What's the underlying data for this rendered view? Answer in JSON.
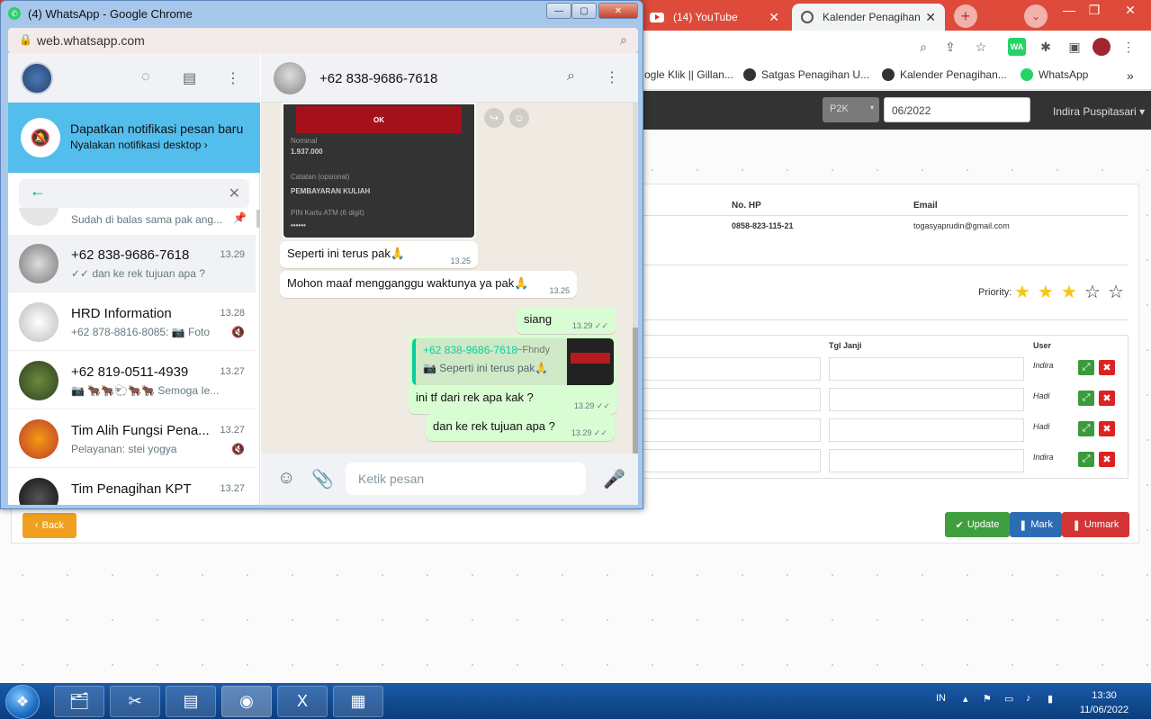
{
  "browser_bg": {
    "tabs": [
      {
        "label": "(14) YouTube"
      },
      {
        "label": "Kalender Penagihan"
      }
    ],
    "bookmarks": [
      {
        "label": "ogle Klik || Gillan..."
      },
      {
        "label": "Satgas Penagihan U..."
      },
      {
        "label": "Kalender Penagihan..."
      },
      {
        "label": "WhatsApp"
      }
    ],
    "wa_ext": "WA"
  },
  "app": {
    "filter_type": "P2K",
    "period": "06/2022",
    "user": "Indira Puspitasari",
    "cols": {
      "nohp": "No. HP",
      "email": "Email"
    },
    "nohp": "0858-823-115-21",
    "email": "togasyaprudin@gmail.com",
    "priority_label": "Priority:",
    "priority_stars": 3,
    "priority_max": 5,
    "table_cols": {
      "tgl": "Tgl Janji",
      "user": "User"
    },
    "rows": [
      {
        "user": "Indira"
      },
      {
        "user": "Hadi"
      },
      {
        "user": "Hadi"
      },
      {
        "user": "Indira"
      }
    ],
    "buttons": {
      "back": "Back",
      "update": "Update",
      "mark": "Mark",
      "unmark": "Unmark"
    }
  },
  "taskbar": {
    "lang": "IN",
    "time": "13:30",
    "date": "11/06/2022"
  },
  "popup": {
    "title": "(4) WhatsApp - Google Chrome",
    "url": "web.whatsapp.com"
  },
  "whatsapp": {
    "notification": {
      "title": "Dapatkan notifikasi pesan baru",
      "subtitle": "Nyalakan notifikasi desktop ›"
    },
    "partial_chat_last": "Sudah di balas sama pak ang...",
    "chats": [
      {
        "name": "+62 838-9686-7618",
        "time": "13.29",
        "last": "✓✓ dan ke rek tujuan apa ?",
        "selected": true
      },
      {
        "name": "HRD Information",
        "time": "13.28",
        "last": "+62 878-8816-8085: 📷 Foto",
        "muted": true
      },
      {
        "name": "+62 819-0511-4939",
        "time": "13.27",
        "last": "📷 🐂🐂🐑🐂🐂 Semoga Ie..."
      },
      {
        "name": "Tim Alih Fungsi Pena...",
        "time": "13.27",
        "last": "Pelayanan: stei yogya",
        "muted": true
      },
      {
        "name": "Tim Penagihan KPT",
        "time": "13.27",
        "last": ""
      }
    ],
    "conversation": {
      "contact": "+62 838-9686-7618",
      "image_card": {
        "button": "OK",
        "field1_label": "Nominal",
        "field1_value": "1.937.000",
        "field2_label": "Catatan (opsional)",
        "field2_value": "PEMBAYARAN KULIAH",
        "field3_label": "PIN Kartu ATM (6 digit)",
        "field3_value": "••••••"
      },
      "messages": [
        {
          "text": "Seperti ini terus pak🙏",
          "time": "13.25",
          "dir": "in"
        },
        {
          "text": "Mohon maaf mengganggu waktunya ya pak🙏",
          "time": "13.25",
          "dir": "in"
        },
        {
          "text": "siang",
          "time": "13.29 ✓✓",
          "dir": "out"
        },
        {
          "text": "ini tf dari rek apa kak ?",
          "time": "13.29 ✓✓",
          "dir": "out"
        },
        {
          "text": "dan ke rek tujuan apa ?",
          "time": "13.29 ✓✓",
          "dir": "out"
        }
      ],
      "quote": {
        "name": "+62 838-9686-7618",
        "sender": "~Fhndy",
        "text": "📷 Seperti ini terus pak🙏"
      },
      "composer_placeholder": "Ketik pesan"
    }
  },
  "colors": {
    "wa_green": "#00a884",
    "notif_blue": "#53bdeb",
    "outgoing_bubble": "#d9fdd3",
    "chrome_tabbar": "#de4b3a"
  }
}
